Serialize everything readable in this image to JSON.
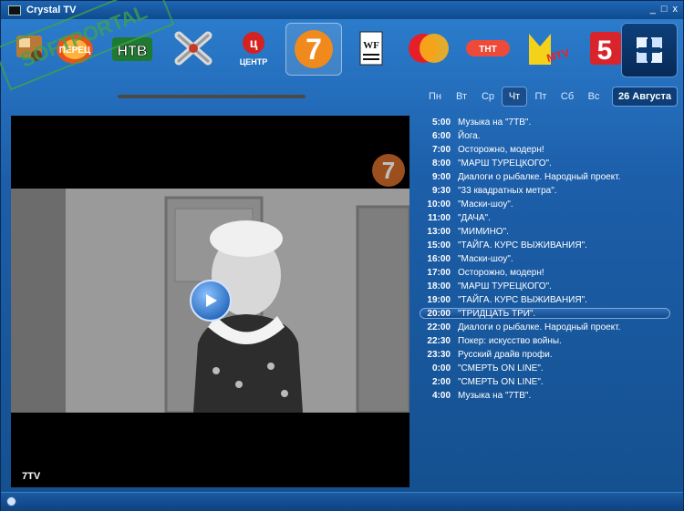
{
  "app": {
    "title": "Crystal TV"
  },
  "window_controls": {
    "minimize": "_",
    "maximize": "□",
    "close": "x"
  },
  "stamp_text": "SOFTPORTAL",
  "channels": [
    {
      "name": "music-channel",
      "label": ""
    },
    {
      "name": "peretz-channel",
      "label": "ПЕРЕЦ"
    },
    {
      "name": "ntv-channel",
      "label": "НТВ"
    },
    {
      "name": "channel-x",
      "label": ""
    },
    {
      "name": "tv-center-channel",
      "label": "ЦЕНТР"
    },
    {
      "name": "7tv-channel",
      "label": "7"
    },
    {
      "name": "world-fashion-channel",
      "label": "WF"
    },
    {
      "name": "muz-tv-channel",
      "label": ""
    },
    {
      "name": "tnt-channel",
      "label": "ТНТ"
    },
    {
      "name": "mtv-channel",
      "label": "MTV"
    },
    {
      "name": "channel-5",
      "label": "5"
    }
  ],
  "days": [
    "Пн",
    "Вт",
    "Ср",
    "Чт",
    "Пт",
    "Сб",
    "Вс"
  ],
  "active_day": "Чт",
  "date_label": "26 Августа",
  "player": {
    "channel_label": "7TV",
    "watermark": "7"
  },
  "schedule": [
    {
      "time": "5:00",
      "title": "Музыка на \"7ТВ\"."
    },
    {
      "time": "6:00",
      "title": "Йога."
    },
    {
      "time": "7:00",
      "title": "Осторожно, модерн!"
    },
    {
      "time": "8:00",
      "title": "\"МАРШ ТУРЕЦКОГО\"."
    },
    {
      "time": "9:00",
      "title": "Диалоги о рыбалке. Народный проект."
    },
    {
      "time": "9:30",
      "title": "\"33 квадратных метра\"."
    },
    {
      "time": "10:00",
      "title": "\"Маски-шоу\"."
    },
    {
      "time": "11:00",
      "title": "\"ДАЧА\"."
    },
    {
      "time": "13:00",
      "title": "\"МИМИНО\"."
    },
    {
      "time": "15:00",
      "title": "\"ТАЙГА. КУРС ВЫЖИВАНИЯ\"."
    },
    {
      "time": "16:00",
      "title": "\"Маски-шоу\"."
    },
    {
      "time": "17:00",
      "title": "Осторожно, модерн!"
    },
    {
      "time": "18:00",
      "title": "\"МАРШ ТУРЕЦКОГО\"."
    },
    {
      "time": "19:00",
      "title": "\"ТАЙГА. КУРС ВЫЖИВАНИЯ\"."
    },
    {
      "time": "20:00",
      "title": "\"ТРИДЦАТЬ ТРИ\".",
      "current": true
    },
    {
      "time": "22:00",
      "title": "Диалоги о рыбалке. Народный проект."
    },
    {
      "time": "22:30",
      "title": "Покер: искусство войны."
    },
    {
      "time": "23:30",
      "title": "Русский драйв профи."
    },
    {
      "time": "0:00",
      "title": "\"СМЕРТЬ ON LINE\"."
    },
    {
      "time": "2:00",
      "title": "\"СМЕРТЬ ON LINE\"."
    },
    {
      "time": "4:00",
      "title": "Музыка на \"7ТВ\"."
    }
  ]
}
